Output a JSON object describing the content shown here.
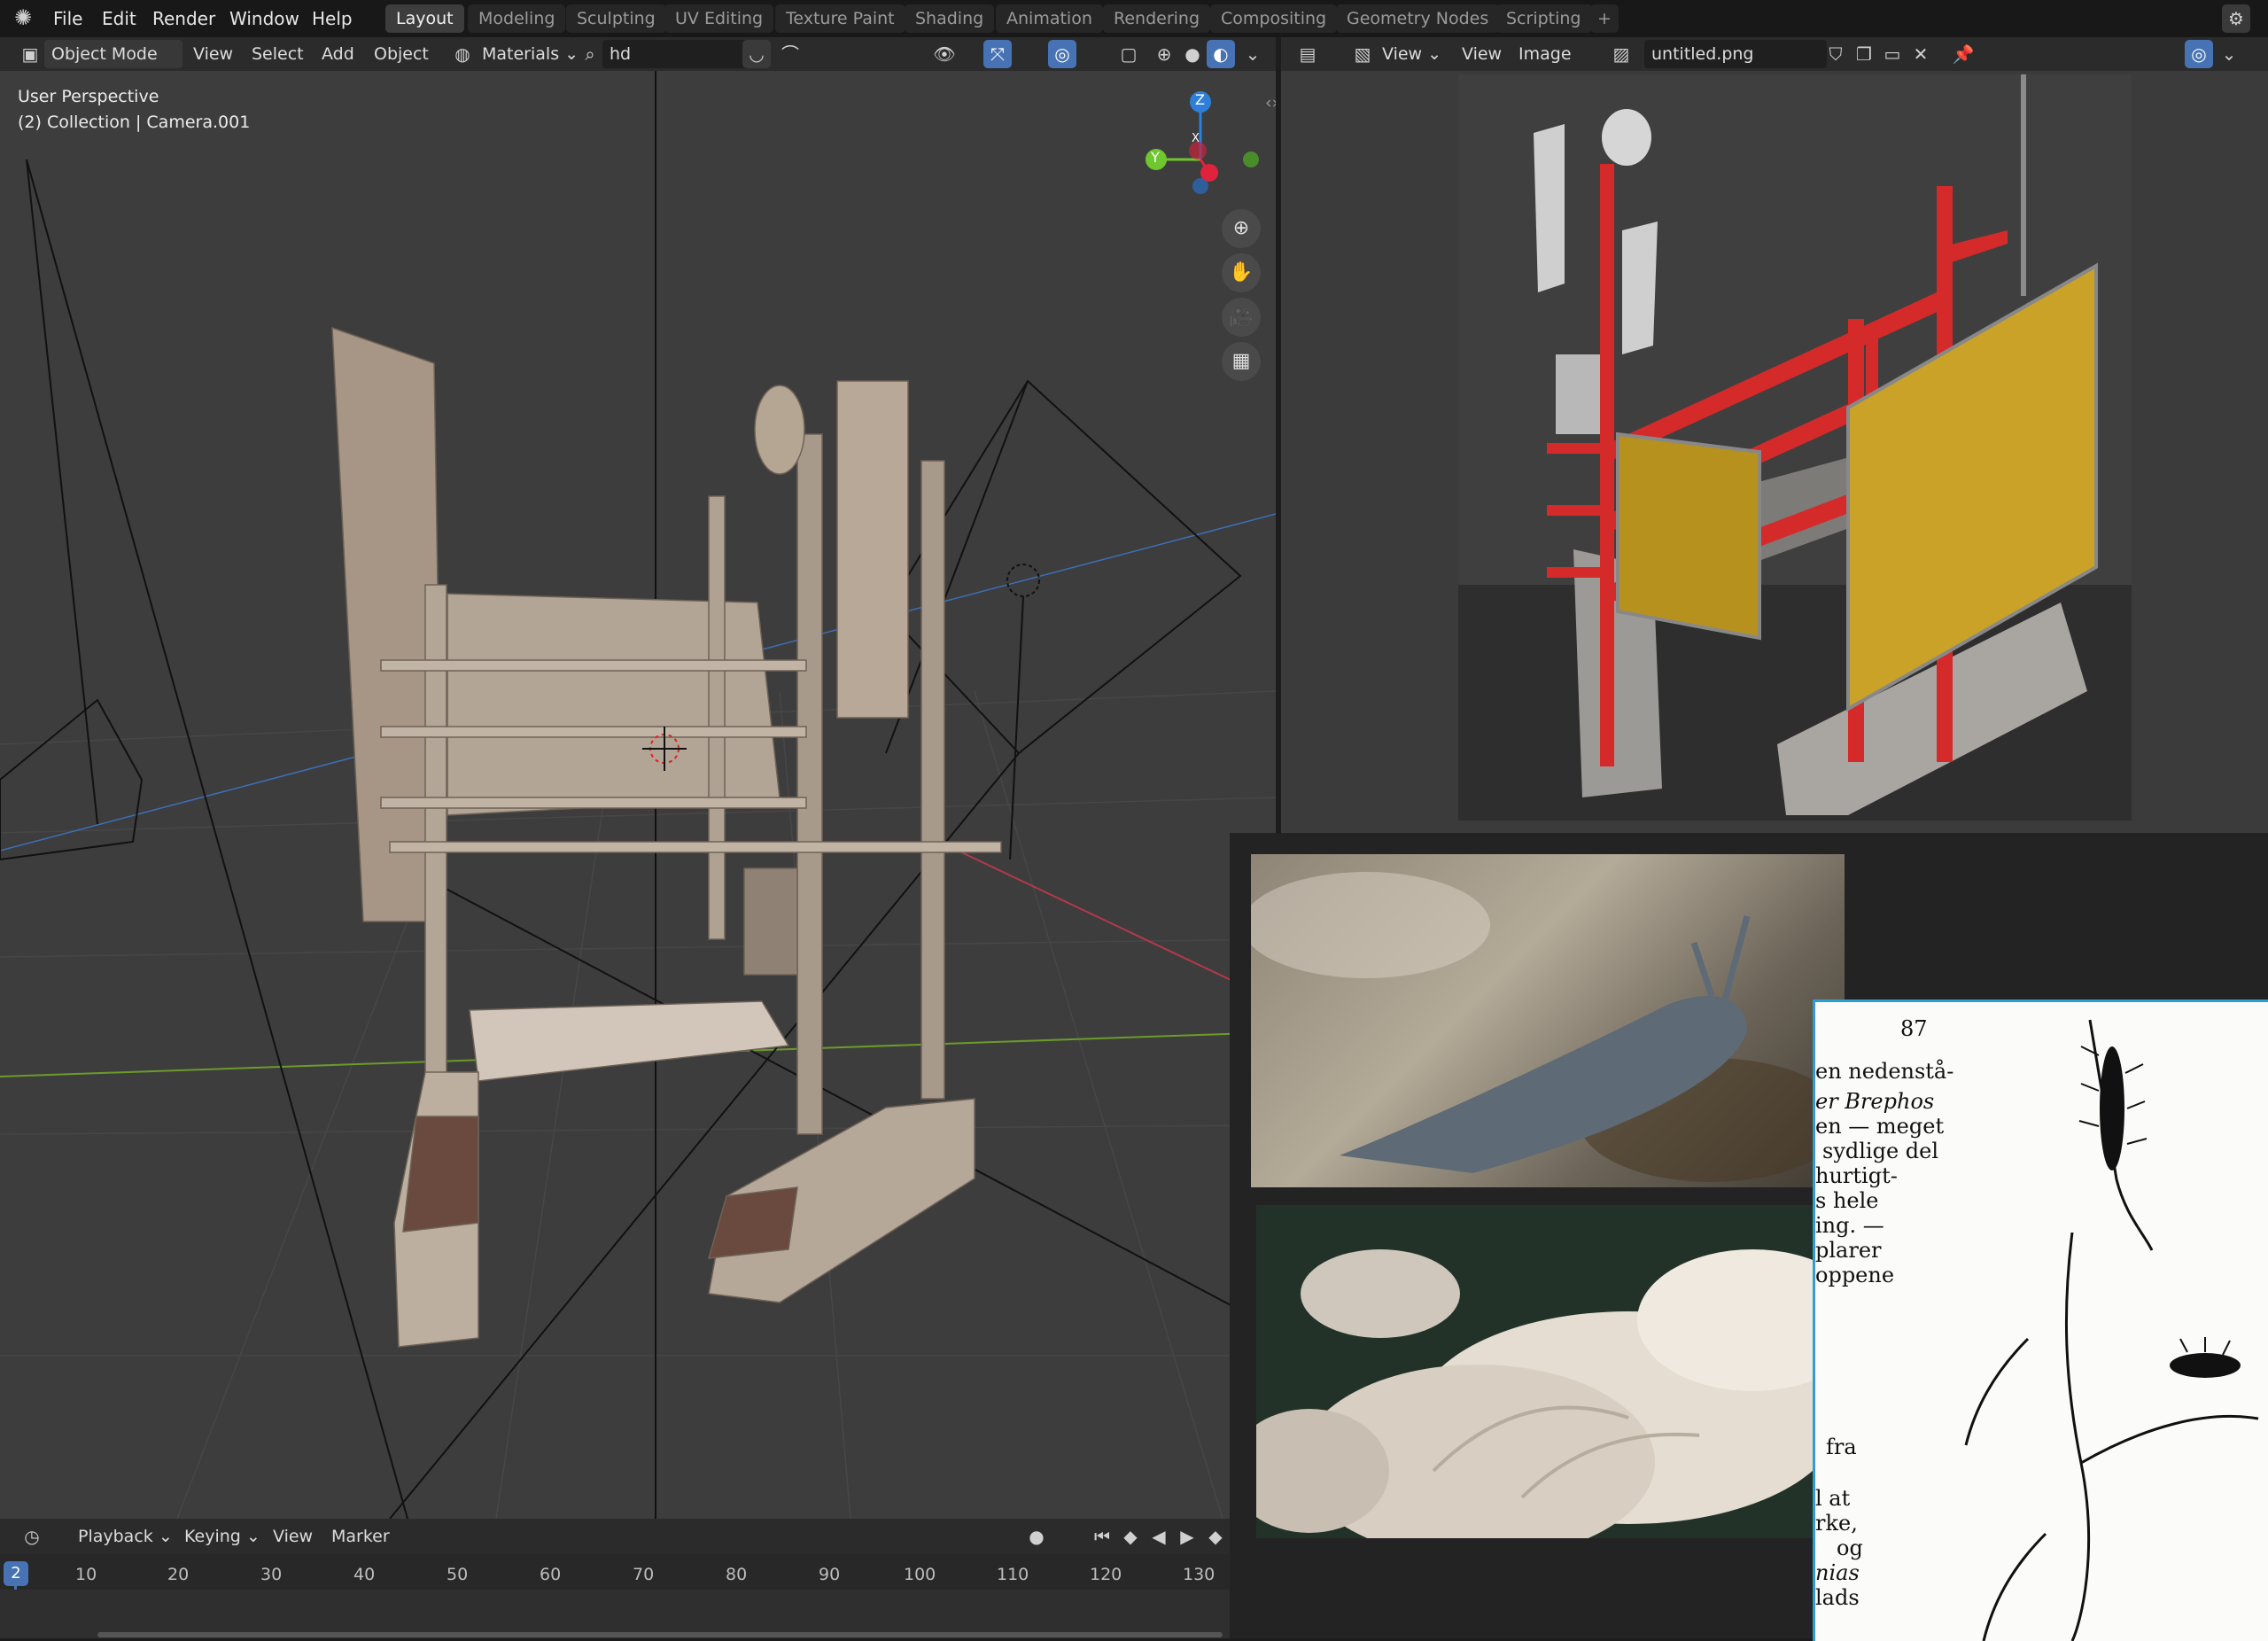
{
  "menubar": {
    "items": [
      "File",
      "Edit",
      "Render",
      "Window",
      "Help"
    ],
    "workspaces": [
      "Layout",
      "Modeling",
      "Sculpting",
      "UV Editing",
      "Texture Paint",
      "Shading",
      "Animation",
      "Rendering",
      "Compositing",
      "Geometry Nodes",
      "Scripting"
    ],
    "active_workspace": "Layout",
    "add_tab": "+"
  },
  "viewport_header": {
    "mode": "Object Mode",
    "menus": [
      "View",
      "Select",
      "Add",
      "Object"
    ],
    "material_dropdown": "Materials",
    "search_value": "hd"
  },
  "viewport": {
    "perspective_label": "User Perspective",
    "collection_label": "(2) Collection | Camera.001",
    "gizmo": {
      "z": "Z",
      "y": "Y",
      "x": "X"
    }
  },
  "image_editor_header": {
    "view_menu": "View",
    "menus": [
      "View",
      "Image"
    ],
    "image_name": "untitled.png"
  },
  "timeline": {
    "menus": [
      "Playback",
      "Keying",
      "View",
      "Marker"
    ],
    "current_frame": "2",
    "ticks": [
      "10",
      "20",
      "30",
      "40",
      "50",
      "60",
      "70",
      "80",
      "90",
      "100",
      "110",
      "120",
      "130"
    ]
  },
  "document_scan": {
    "page_number": "87",
    "lines": [
      "en nedenstå-",
      "er Brephos",
      "en — meget",
      "sydlige del",
      "hurtigt-",
      "s hele",
      "ing. —",
      "plarer",
      "oppene",
      "fra",
      "l at",
      "rke,",
      "og",
      "nias",
      "lads"
    ]
  },
  "colors": {
    "accent": "#4772b3",
    "frame_marker": "#4772b3",
    "render_red": "#d52a2a",
    "render_gold": "#c9a227"
  }
}
